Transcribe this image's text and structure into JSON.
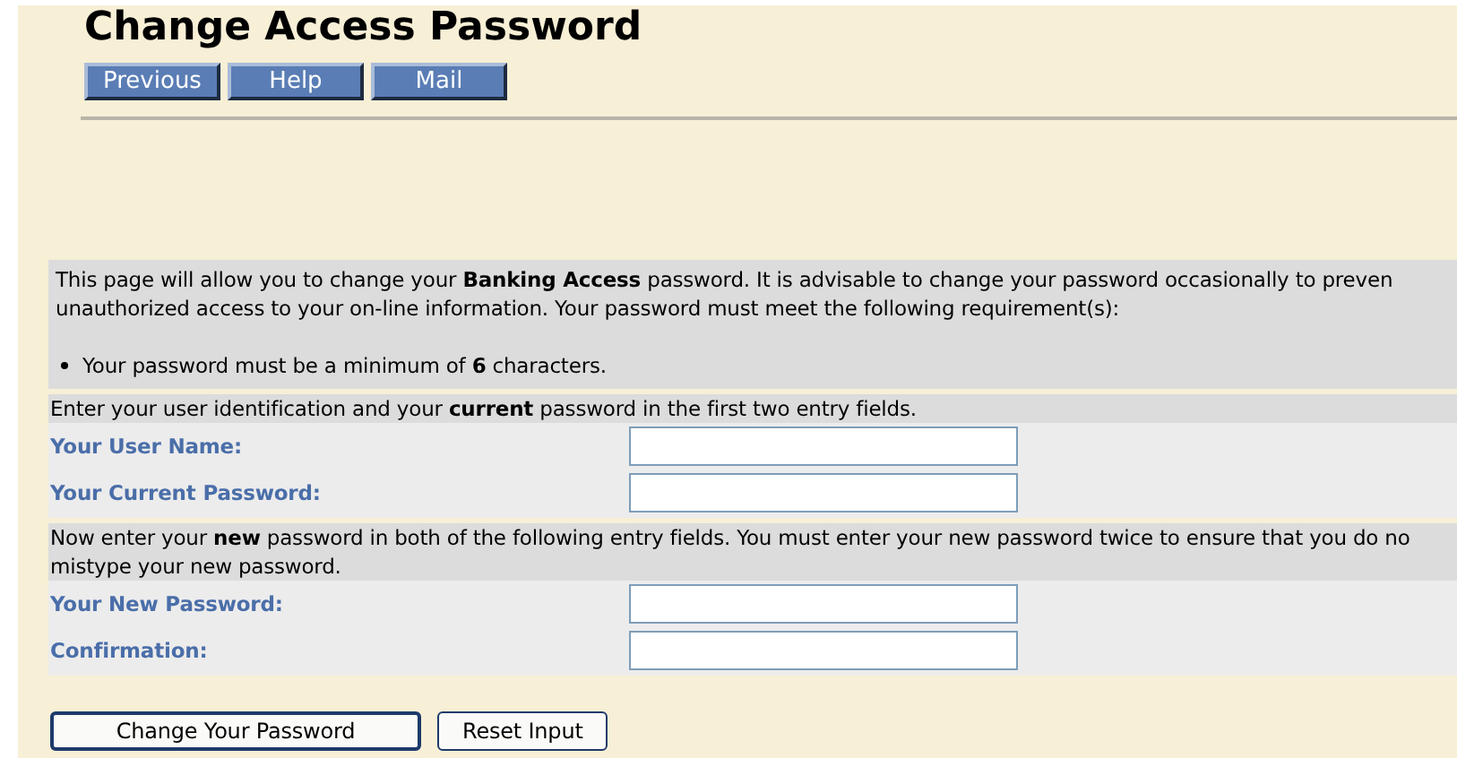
{
  "title": "Change Access Password",
  "nav_buttons": [
    "Previous",
    "Help",
    "Mail"
  ],
  "intro": {
    "lines": [
      "This page will allow you to change your **Banking Access** password. It is advisable to change your password occasionally to preven",
      "unauthorized access to your on-line information. Your password must meet the following requirement(s):"
    ],
    "requirements": [
      "Your password must be a minimum of **6** characters."
    ]
  },
  "sections": [
    {
      "instruction_lines": [
        "Enter your user identification and your **current** password in the first two entry fields."
      ],
      "fields": [
        {
          "label": "Your User Name:"
        },
        {
          "label": "Your Current Password:"
        }
      ]
    },
    {
      "instruction_lines": [
        "Now enter your **new** password in both of the following entry fields. You must enter your new password twice to ensure that you do no",
        "mistype your new password."
      ],
      "fields": [
        {
          "label": "Your New Password:"
        },
        {
          "label": "Confirmation:"
        }
      ]
    }
  ],
  "actions": [
    {
      "label": "Change Your Password",
      "kind": "default"
    },
    {
      "label": "Reset Input",
      "kind": "normal"
    }
  ]
}
